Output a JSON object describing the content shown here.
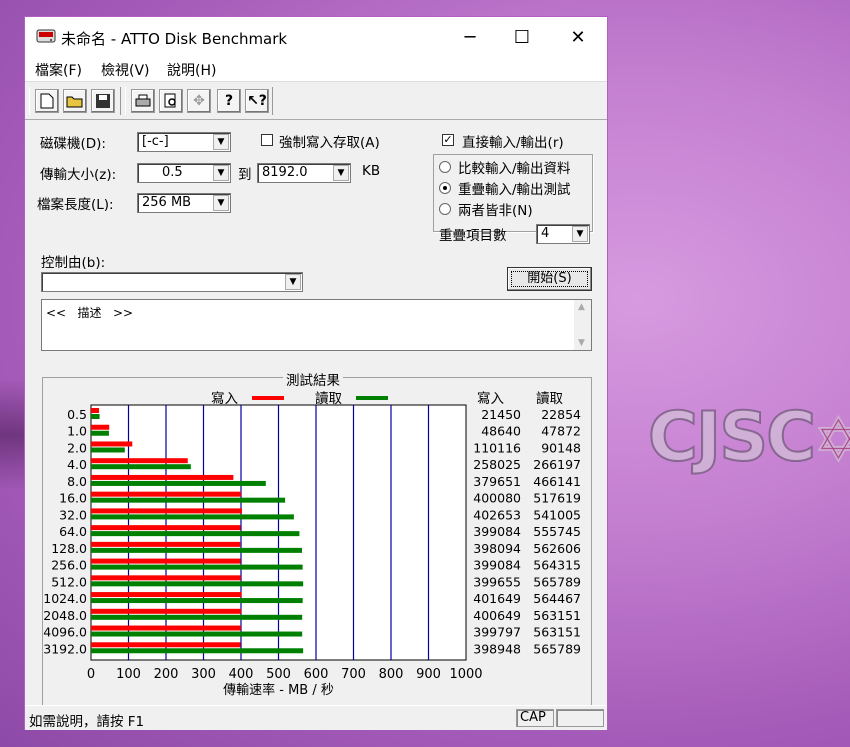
{
  "window": {
    "title": "未命名 - ATTO Disk Benchmark",
    "minimize_glyph": "─",
    "maximize_glyph": "☐",
    "close_glyph": "✕"
  },
  "menu": [
    {
      "label": "檔案(F)"
    },
    {
      "label": "檢視(V)"
    },
    {
      "label": "說明(H)"
    }
  ],
  "toolbar": {
    "icons": [
      "new-file-icon",
      "open-folder-icon",
      "save-icon",
      "print-icon",
      "print-preview-icon",
      "move-icon",
      "help-icon",
      "context-help-icon"
    ]
  },
  "form": {
    "drive_label": "磁碟機(D):",
    "drive_value": "[-c-]",
    "force_write_label": "強制寫入存取(A)",
    "force_write_checked": false,
    "direct_io_label": "直接輸入/輸出(r)",
    "direct_io_checked": true,
    "transfer_label": "傳輸大小(z):",
    "transfer_from": "0.5",
    "to_label": "到",
    "transfer_to": "8192.0",
    "kb_label": "KB",
    "file_length_label": "檔案長度(L):",
    "file_length_value": "256 MB",
    "radio_compare": "比較輸入/輸出資料",
    "radio_overlap": "重疊輸入/輸出測試",
    "radio_neither": "兩者皆非(N)",
    "selected_radio": "radio_overlap",
    "queue_label": "重疊項目數",
    "queue_value": "4",
    "controlled_by_label": "控制由(b):",
    "controlled_by_value": "",
    "start_button": "開始(S)",
    "description_text": "<<   描述   >>"
  },
  "results": {
    "title": "測試結果",
    "legend_write": "寫入",
    "legend_read": "讀取",
    "col_write": "寫入",
    "col_read": "讀取",
    "write_color": "#ff0000",
    "read_color": "#008000"
  },
  "chart_data": {
    "type": "bar",
    "orientation": "horizontal",
    "categories": [
      "0.5",
      "1.0",
      "2.0",
      "4.0",
      "8.0",
      "16.0",
      "32.0",
      "64.0",
      "128.0",
      "256.0",
      "512.0",
      "1024.0",
      "2048.0",
      "4096.0",
      "3192.0"
    ],
    "series": [
      {
        "name": "寫入",
        "values": [
          21450,
          48640,
          110116,
          258025,
          379651,
          400080,
          402653,
          399084,
          398094,
          399084,
          399655,
          401649,
          400649,
          399797,
          398948
        ]
      },
      {
        "name": "讀取",
        "values": [
          22854,
          47872,
          90148,
          266197,
          466141,
          517619,
          541005,
          555745,
          562606,
          564315,
          565789,
          564467,
          563151,
          563151,
          565789
        ]
      }
    ],
    "xlabel": "傳輸速率 - MB / 秒",
    "xticks": [
      "0",
      "100",
      "200",
      "300",
      "400",
      "500",
      "600",
      "700",
      "800",
      "900",
      "1000"
    ],
    "xlim": [
      0,
      1000
    ],
    "grid": true
  },
  "status": {
    "help_text": "如需說明，請按 F1",
    "cap": "CAP"
  }
}
